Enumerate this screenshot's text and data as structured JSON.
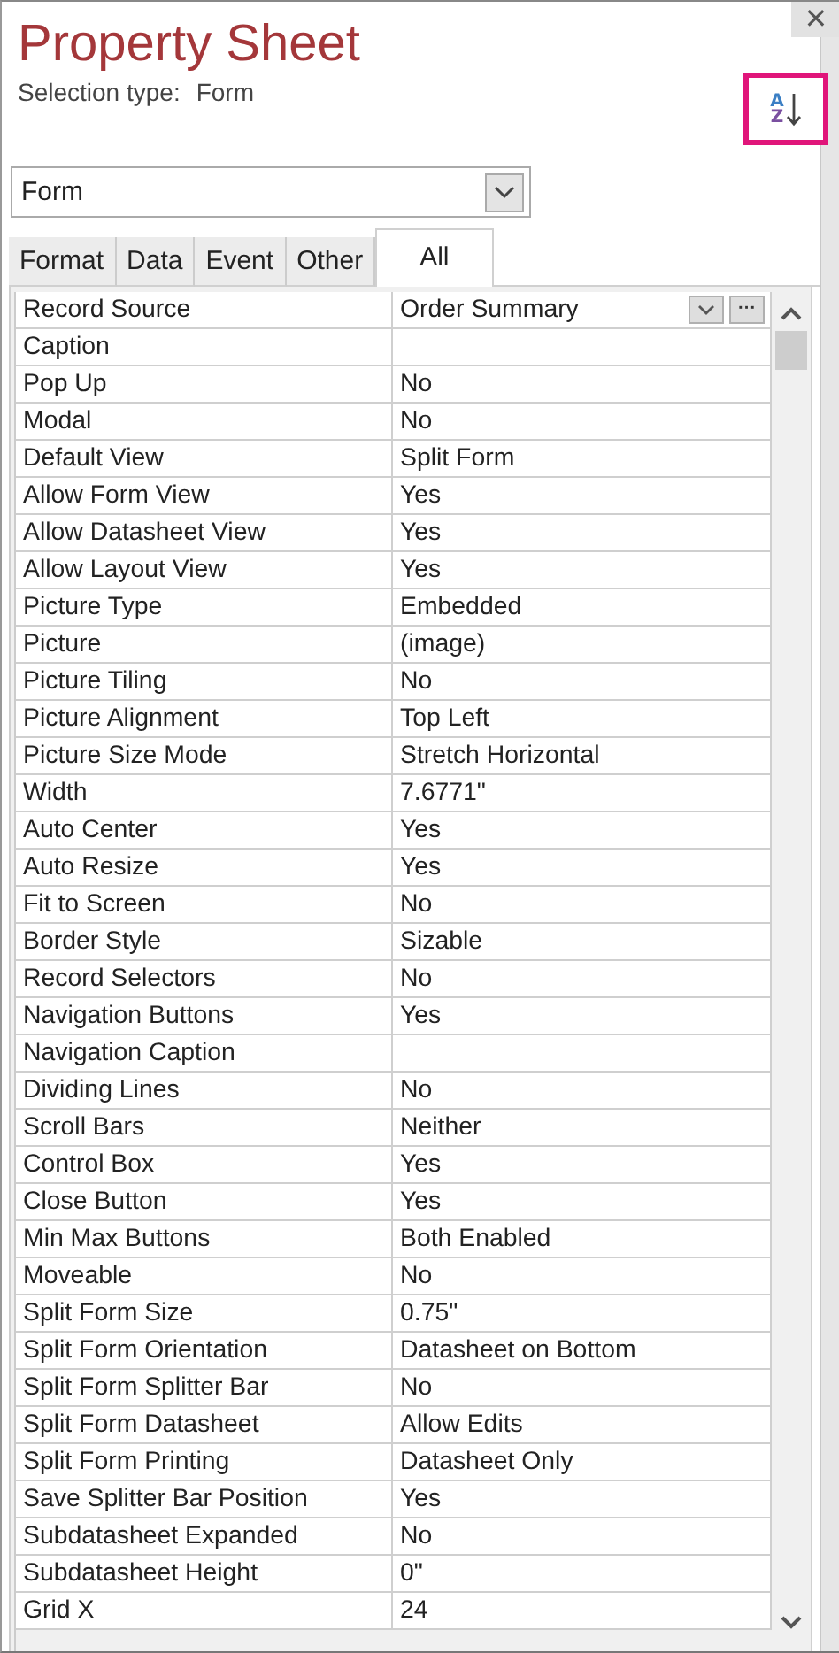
{
  "window": {
    "title": "Property Sheet",
    "close_button": "✕"
  },
  "selection_type": {
    "label": "Selection type:",
    "value": "Form"
  },
  "sort_button": {
    "top_letter": "A",
    "bottom_letter": "Z",
    "highlighted": true
  },
  "object_dropdown": {
    "value": "Form"
  },
  "tabs": [
    {
      "label": "Format",
      "selected": false
    },
    {
      "label": "Data",
      "selected": false
    },
    {
      "label": "Event",
      "selected": false
    },
    {
      "label": "Other",
      "selected": false
    },
    {
      "label": "All",
      "selected": true
    }
  ],
  "properties": [
    {
      "name": "Record Source",
      "value": "Order Summary",
      "kind": "combo",
      "ellipsis": "···"
    },
    {
      "name": "Caption",
      "kind": "plain"
    },
    {
      "name": "Pop Up",
      "value": "No",
      "kind": "plain"
    },
    {
      "name": "Modal",
      "value": "No",
      "kind": "plain"
    },
    {
      "name": "Default View",
      "value": "Split Form",
      "kind": "plain"
    },
    {
      "name": "Allow Form View",
      "value": "Yes",
      "kind": "plain"
    },
    {
      "name": "Allow Datasheet View",
      "value": "Yes",
      "kind": "plain"
    },
    {
      "name": "Allow Layout View",
      "value": "Yes",
      "kind": "plain"
    },
    {
      "name": "Picture Type",
      "value": "Embedded",
      "kind": "plain"
    },
    {
      "name": "Picture",
      "value": "(image)",
      "kind": "plain"
    },
    {
      "name": "Picture Tiling",
      "value": "No",
      "kind": "plain"
    },
    {
      "name": "Picture Alignment",
      "value": "Top Left",
      "kind": "plain"
    },
    {
      "name": "Picture Size Mode",
      "value": "Stretch Horizontal",
      "kind": "plain"
    },
    {
      "name": "Width",
      "value": "7.6771\"",
      "kind": "plain"
    },
    {
      "name": "Auto Center",
      "value": "Yes",
      "kind": "plain"
    },
    {
      "name": "Auto Resize",
      "value": "Yes",
      "kind": "plain"
    },
    {
      "name": "Fit to Screen",
      "value": "No",
      "kind": "plain"
    },
    {
      "name": "Border Style",
      "value": "Sizable",
      "kind": "plain"
    },
    {
      "name": "Record Selectors",
      "value": "No",
      "kind": "plain"
    },
    {
      "name": "Navigation Buttons",
      "value": "Yes",
      "kind": "plain"
    },
    {
      "name": "Navigation Caption",
      "kind": "plain"
    },
    {
      "name": "Dividing Lines",
      "value": "No",
      "kind": "plain"
    },
    {
      "name": "Scroll Bars",
      "value": "Neither",
      "kind": "plain"
    },
    {
      "name": "Control Box",
      "value": "Yes",
      "kind": "plain"
    },
    {
      "name": "Close Button",
      "value": "Yes",
      "kind": "plain"
    },
    {
      "name": "Min Max Buttons",
      "value": "Both Enabled",
      "kind": "plain"
    },
    {
      "name": "Moveable",
      "value": "No",
      "kind": "plain"
    },
    {
      "name": "Split Form Size",
      "value": "0.75\"",
      "kind": "plain"
    },
    {
      "name": "Split Form Orientation",
      "value": "Datasheet on Bottom",
      "kind": "plain"
    },
    {
      "name": "Split Form Splitter Bar",
      "value": "No",
      "kind": "plain"
    },
    {
      "name": "Split Form Datasheet",
      "value": "Allow Edits",
      "kind": "plain"
    },
    {
      "name": "Split Form Printing",
      "value": "Datasheet Only",
      "kind": "plain"
    },
    {
      "name": "Save Splitter Bar Position",
      "value": "Yes",
      "kind": "plain"
    },
    {
      "name": "Subdatasheet Expanded",
      "value": "No",
      "kind": "plain"
    },
    {
      "name": "Subdatasheet Height",
      "value": "0\"",
      "kind": "plain"
    },
    {
      "name": "Grid X",
      "value": "24",
      "kind": "plain"
    }
  ]
}
